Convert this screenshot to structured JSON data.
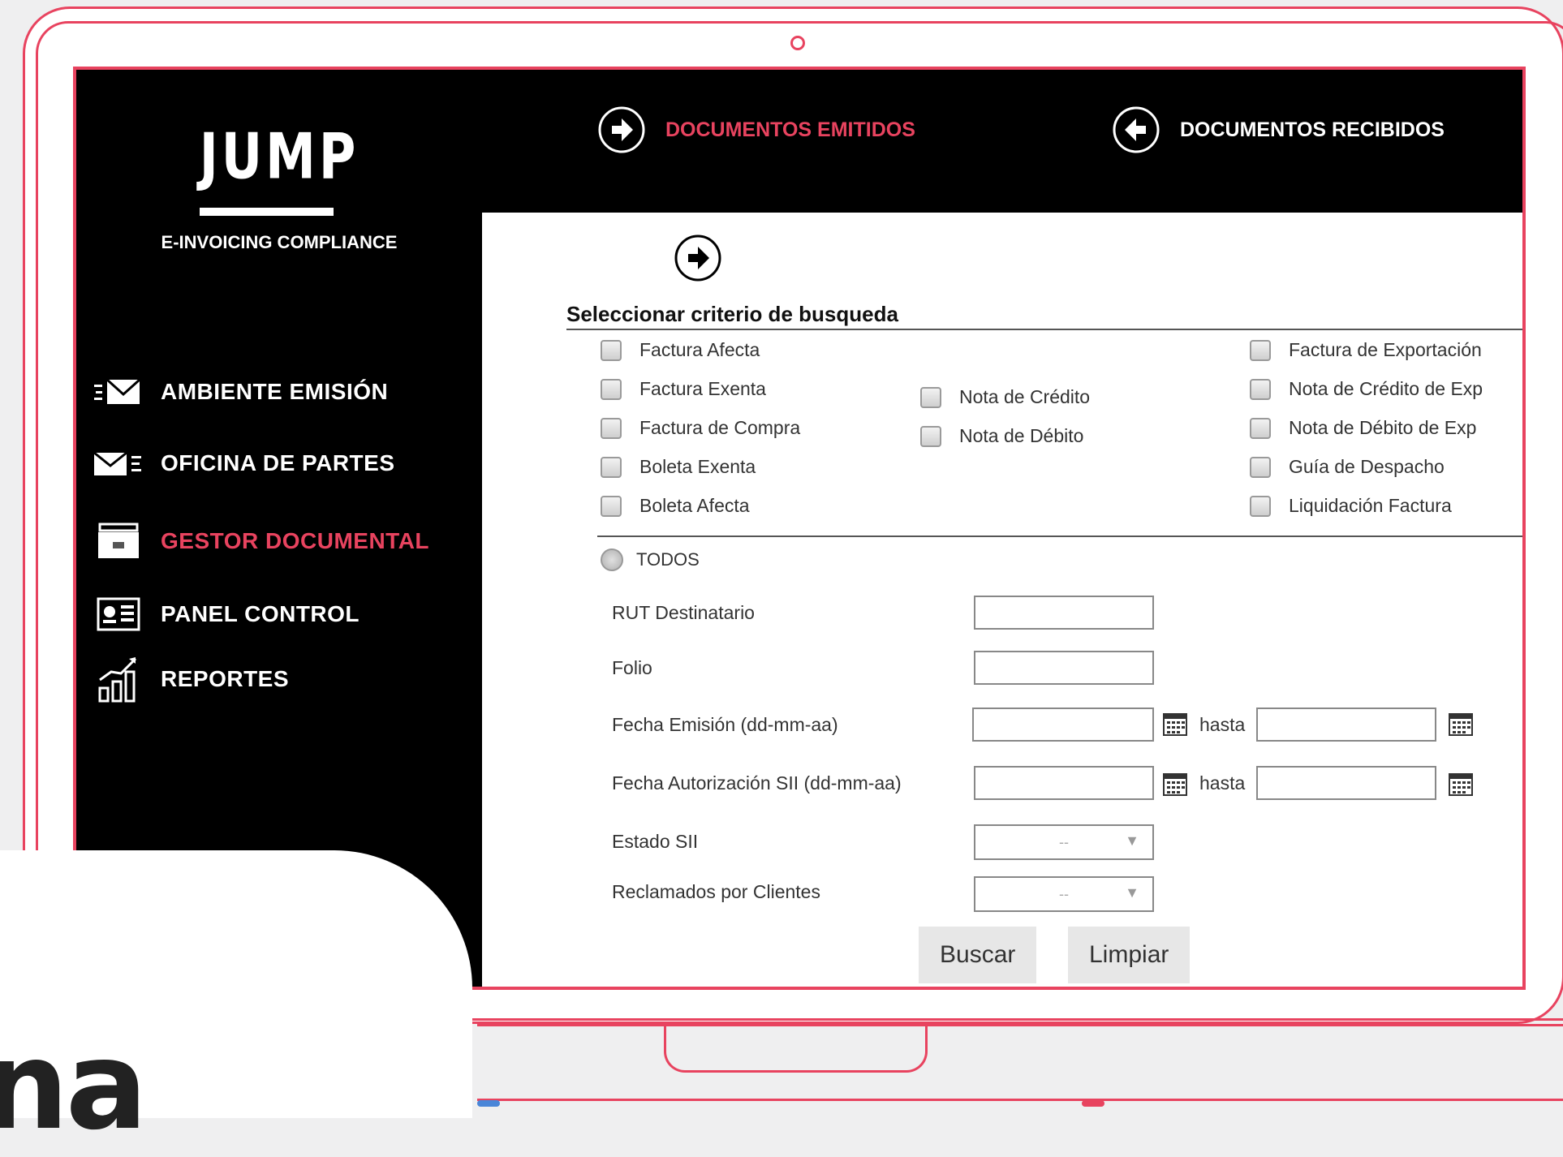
{
  "brand": {
    "logo": "JUMP",
    "tagline": "E-INVOICING COMPLIANCE"
  },
  "sidebar": {
    "items": [
      {
        "label": "AMBIENTE EMISIÓN",
        "icon": "mail-send-icon",
        "active": false
      },
      {
        "label": "OFICINA DE PARTES",
        "icon": "mail-receive-icon",
        "active": false
      },
      {
        "label": "GESTOR DOCUMENTAL",
        "icon": "folder-icon",
        "active": true
      },
      {
        "label": "PANEL CONTROL",
        "icon": "dashboard-icon",
        "active": false
      },
      {
        "label": "REPORTES",
        "icon": "bar-chart-icon",
        "active": false
      }
    ]
  },
  "topnav": {
    "emitidos": "DOCUMENTOS EMITIDOS",
    "recibidos": "DOCUMENTOS RECIBIDOS"
  },
  "search": {
    "title": "Seleccionar criterio de busqueda",
    "doc_types_col1": [
      "Factura Afecta",
      "Factura Exenta",
      "Factura de Compra",
      "Boleta Exenta",
      "Boleta Afecta"
    ],
    "doc_types_col2": [
      "Nota de Crédito",
      "Nota de Débito"
    ],
    "doc_types_col3": [
      "Factura de Exportación",
      "Nota de Crédito de Exp",
      "Nota de Débito de Exp",
      "Guía de Despacho",
      "Liquidación Factura"
    ],
    "all_label": "TODOS",
    "fields": {
      "rut": "RUT Destinatario",
      "folio": "Folio",
      "fecha_emision": "Fecha Emisión (dd-mm-aa)",
      "fecha_autorizacion": "Fecha Autorización SII (dd-mm-aa)",
      "estado": "Estado SII",
      "reclamados": "Reclamados por Clientes"
    },
    "hasta": "hasta",
    "select_placeholder": "--",
    "buscar": "Buscar",
    "limpiar": "Limpiar"
  },
  "overlay": {
    "text": "na"
  },
  "colors": {
    "accent": "#e8435f",
    "screen_bg": "#000000",
    "page_bg": "#efeff0"
  }
}
